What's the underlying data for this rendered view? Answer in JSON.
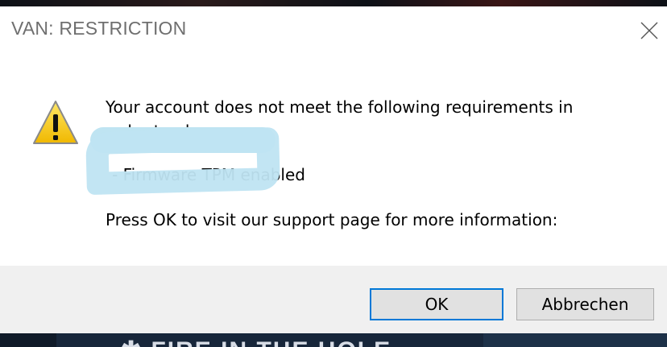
{
  "dialog": {
    "title": "VAN: RESTRICTION",
    "message_line1": "Your account does not meet the following requirements in",
    "message_line2": "order to play:",
    "requirement_line": "- Firmware TPM        enabled",
    "message_line4": "Press OK to visit our support page for more information:",
    "ok_label": "OK",
    "cancel_label": "Abbrechen"
  },
  "background": {
    "bottom_text": "✱ FIRE IN THE HOLE"
  },
  "icons": {
    "warning": "warning-icon",
    "close": "close-icon"
  },
  "colors": {
    "accent": "#0078d7",
    "redaction": "#bfe4f2",
    "footer": "#f0f0f0",
    "warning_yellow": "#f2c200"
  }
}
